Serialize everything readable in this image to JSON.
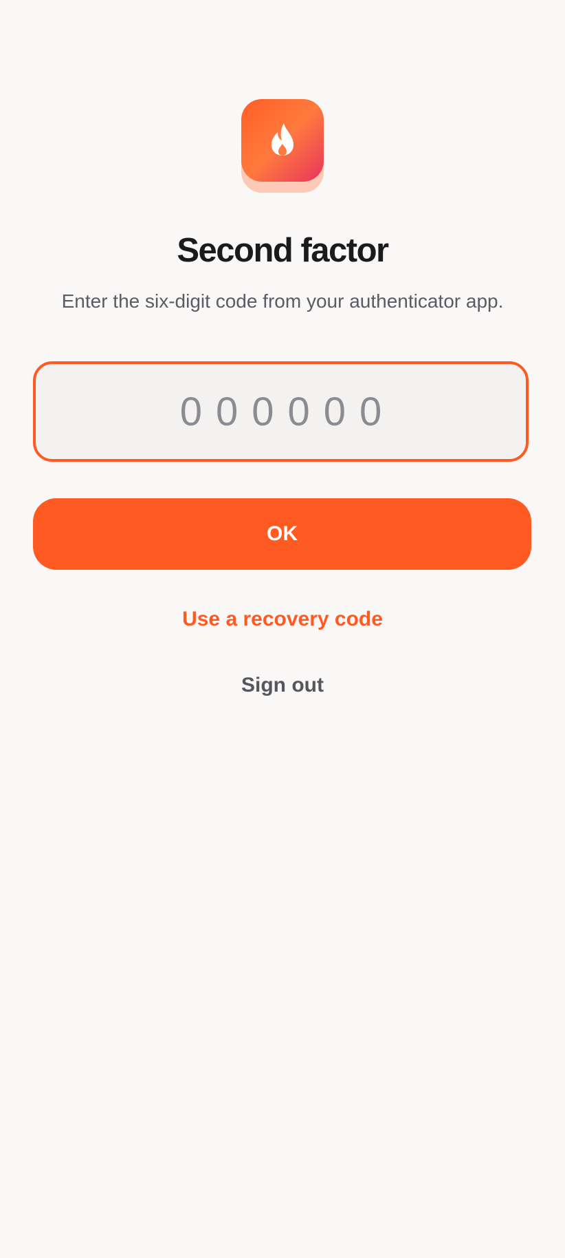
{
  "app": {
    "logo_icon": "flame-icon",
    "accent_color": "#ff5a22",
    "gradient_end_color": "#e8345c"
  },
  "header": {
    "title": "Second factor",
    "subtitle": "Enter the six-digit code from your authenticator app."
  },
  "form": {
    "code_value": "",
    "code_placeholder": "000000",
    "submit_label": "OK"
  },
  "links": {
    "recovery_label": "Use a recovery code",
    "signout_label": "Sign out"
  }
}
